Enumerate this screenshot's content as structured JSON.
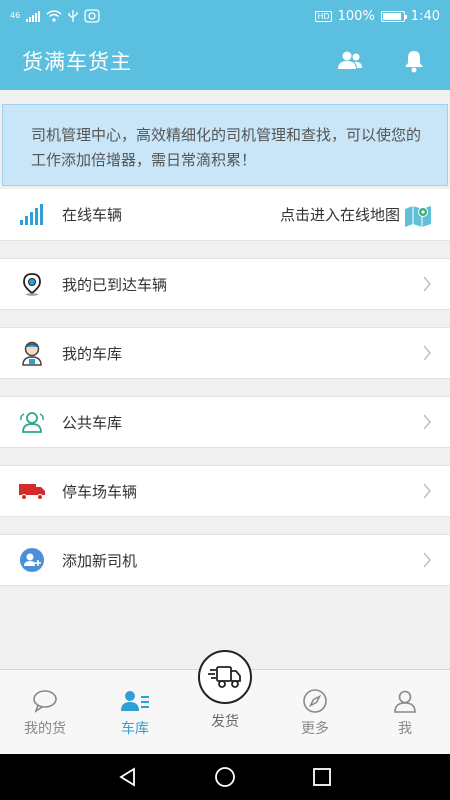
{
  "status_bar": {
    "network": "46",
    "battery_pct": "100%",
    "time": "1:40",
    "hd": "HD"
  },
  "header": {
    "title": "货满车货主"
  },
  "notice": {
    "text": "司机管理中心，高效精细化的司机管理和查找，可以使您的工作添加倍增器，需日常滴积累！"
  },
  "menu": {
    "online": {
      "label": "在线车辆",
      "action": "点击进入在线地图"
    },
    "arrived": {
      "label": "我的已到达车辆"
    },
    "garage": {
      "label": "我的车库"
    },
    "public": {
      "label": "公共车库"
    },
    "parking": {
      "label": "停车场车辆"
    },
    "add_driver": {
      "label": "添加新司机"
    }
  },
  "nav": {
    "my_goods": "我的货",
    "garage": "车库",
    "ship": "发货",
    "more": "更多",
    "me": "我"
  },
  "colors": {
    "primary": "#5bbfe0",
    "active": "#2f9fd8",
    "notice_bg": "#c8e6f8",
    "truck_red": "#d42a2a",
    "green_icon": "#2aa889"
  }
}
